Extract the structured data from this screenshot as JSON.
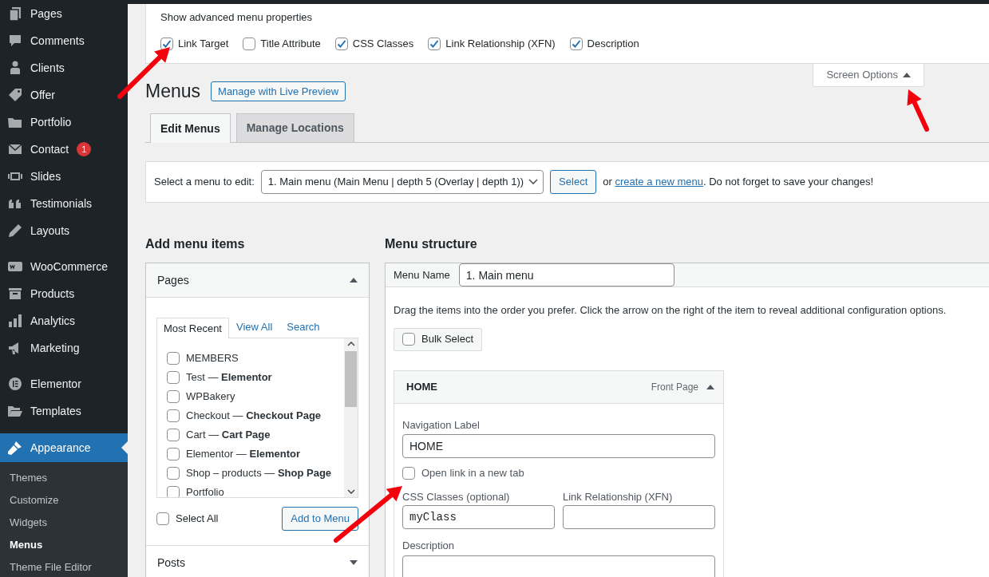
{
  "sidebar": {
    "groups": [
      [
        {
          "label": "Pages",
          "selected": false
        },
        {
          "label": "Comments",
          "selected": false
        },
        {
          "label": "Clients",
          "selected": false
        },
        {
          "label": "Offer",
          "selected": false
        },
        {
          "label": "Portfolio",
          "selected": false
        },
        {
          "label": "Contact",
          "selected": false,
          "badge": "1"
        },
        {
          "label": "Slides",
          "selected": false
        },
        {
          "label": "Testimonials",
          "selected": false
        },
        {
          "label": "Layouts",
          "selected": false
        }
      ],
      [
        {
          "label": "WooCommerce",
          "selected": false
        },
        {
          "label": "Products",
          "selected": false
        },
        {
          "label": "Analytics",
          "selected": false
        },
        {
          "label": "Marketing",
          "selected": false
        }
      ],
      [
        {
          "label": "Elementor",
          "selected": false
        },
        {
          "label": "Templates",
          "selected": false
        }
      ],
      [
        {
          "label": "Appearance",
          "selected": true,
          "submenu": [
            {
              "label": "Themes",
              "selected": false
            },
            {
              "label": "Customize",
              "selected": false
            },
            {
              "label": "Widgets",
              "selected": false
            },
            {
              "label": "Menus",
              "selected": true
            },
            {
              "label": "Theme File Editor",
              "selected": false
            }
          ]
        }
      ]
    ]
  },
  "screen_options": {
    "heading": "Show advanced menu properties",
    "options": [
      {
        "label": "Link Target",
        "checked": true
      },
      {
        "label": "Title Attribute",
        "checked": false
      },
      {
        "label": "CSS Classes",
        "checked": true
      },
      {
        "label": "Link Relationship (XFN)",
        "checked": true
      },
      {
        "label": "Description",
        "checked": true
      }
    ],
    "tab": {
      "label": "Screen Options",
      "expanded": true
    }
  },
  "page": {
    "title": "Menus",
    "action_button": "Manage with Live Preview"
  },
  "tabs": [
    {
      "label": "Edit Menus",
      "selected": true
    },
    {
      "label": "Manage Locations",
      "selected": false
    }
  ],
  "menu_select": {
    "label": "Select a menu to edit:",
    "value": "1. Main menu (Main Menu | depth 5 (Overlay | depth 1))",
    "button": "Select",
    "note_before": "or ",
    "link": "create a new menu",
    "note_after": ". Do not forget to save your changes!"
  },
  "add_items": {
    "title": "Add menu items",
    "panels": [
      {
        "title": "Pages",
        "expanded": true,
        "tabs": [
          {
            "label": "Most Recent",
            "selected": true
          },
          {
            "label": "View All",
            "selected": false
          },
          {
            "label": "Search",
            "selected": false
          }
        ],
        "items": [
          {
            "label": "MEMBERS",
            "checked": false
          },
          {
            "label": "Test — **Elementor**",
            "checked": false
          },
          {
            "label": "WPBakery",
            "checked": false
          },
          {
            "label": "Checkout — **Checkout Page**",
            "checked": false
          },
          {
            "label": "Cart — **Cart Page**",
            "checked": false
          },
          {
            "label": "Elementor — **Elementor**",
            "checked": false
          },
          {
            "label": "Shop – products — **Shop Page**",
            "checked": false
          },
          {
            "label": "Portfolio",
            "checked": false
          }
        ],
        "select_all": {
          "label": "Select All",
          "checked": false
        },
        "button": "Add to Menu"
      },
      {
        "title": "Posts",
        "expanded": false
      }
    ]
  },
  "menu_structure": {
    "title": "Menu structure",
    "name_label": "Menu Name",
    "name_value": "1. Main menu",
    "instructions": "Drag the items into the order you prefer. Click the arrow on the right of the item to reveal additional configuration options.",
    "bulk_select": {
      "label": "Bulk Select",
      "checked": false
    },
    "items": [
      {
        "title": "HOME",
        "type": "Front Page",
        "expanded": true,
        "navigation_label": {
          "label": "Navigation Label",
          "value": "HOME"
        },
        "open_new_tab": {
          "label": "Open link in a new tab",
          "checked": false
        },
        "css_classes": {
          "label": "CSS Classes (optional)",
          "value": "myClass"
        },
        "xfn": {
          "label": "Link Relationship (XFN)"
        },
        "description": {
          "label": "Description"
        }
      }
    ]
  }
}
